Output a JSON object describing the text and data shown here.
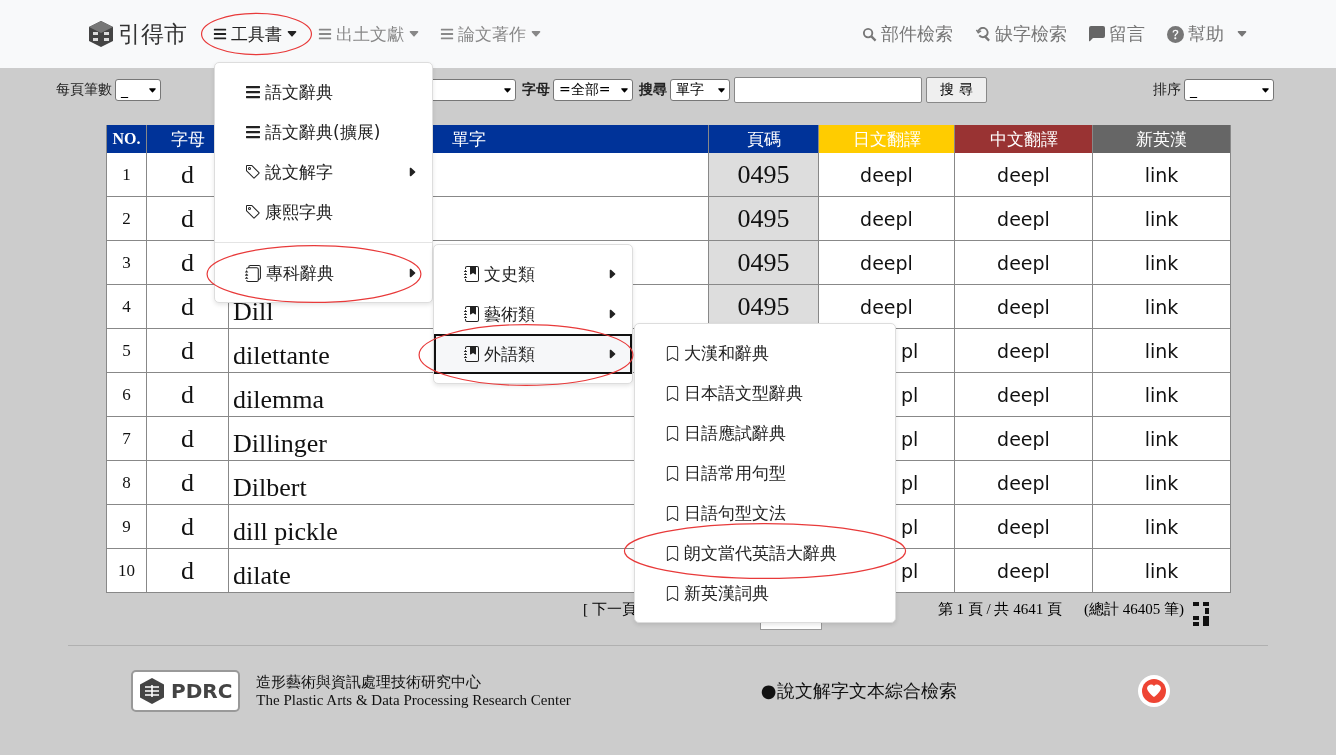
{
  "nav": {
    "brand": "引得市",
    "items": [
      {
        "label": "工具書",
        "selected": true,
        "circled": true
      },
      {
        "label": "出土文獻",
        "selected": false,
        "circled": false
      },
      {
        "label": "論文著作",
        "selected": false,
        "circled": false
      }
    ],
    "right": [
      {
        "label": "部件檢索",
        "kind": "search"
      },
      {
        "label": "缺字檢索",
        "kind": "lookup"
      },
      {
        "label": "留言",
        "kind": "messages"
      },
      {
        "label": "幫助",
        "kind": "help"
      }
    ]
  },
  "filters": {
    "per_page_label": "每頁筆數",
    "per_page": "_",
    "letter_label": "字母",
    "letter": "=全部=",
    "search_label": "搜尋",
    "search_mode": "單字",
    "button": "搜 尋",
    "sort_label": "排序",
    "sort": "_"
  },
  "table": {
    "columns": [
      {
        "label": "NO.",
        "color": "#003399"
      },
      {
        "label": "字母",
        "color": "#003399"
      },
      {
        "label": "單字",
        "color": "#003399"
      },
      {
        "label": "頁碼",
        "color": "#003399"
      },
      {
        "label": "日文翻譯",
        "color": "#ffcc00"
      },
      {
        "label": "中文翻譯",
        "color": "#993333"
      },
      {
        "label": "新英漢",
        "color": "#666666"
      }
    ],
    "rows": [
      {
        "no": "1",
        "letter": "d",
        "page": "0495",
        "ja": "deepl",
        "zh": "deepl",
        "en": "link"
      },
      {
        "no": "2",
        "letter": "d",
        "page": "0495",
        "ja": "deepl",
        "zh": "deepl",
        "en": "link"
      },
      {
        "no": "3",
        "letter": "d",
        "page": "0495",
        "ja": "deepl",
        "zh": "deepl",
        "en": "link"
      },
      {
        "no": "4",
        "letter": "d",
        "word": "Dill",
        "page": "0495",
        "ja": "deepl",
        "zh": "deepl",
        "en": "link"
      },
      {
        "no": "5",
        "letter": "d",
        "word": "dilettante",
        "ja": "pl",
        "ja_clipped": true,
        "zh": "deepl",
        "en": "link"
      },
      {
        "no": "6",
        "letter": "d",
        "word": "dilemma",
        "ja": "pl",
        "ja_clipped": true,
        "zh": "deepl",
        "en": "link"
      },
      {
        "no": "7",
        "letter": "d",
        "word": "Dillinger",
        "ja": "pl",
        "ja_clipped": true,
        "zh": "deepl",
        "en": "link"
      },
      {
        "no": "8",
        "letter": "d",
        "word": "Dilbert",
        "ja": "pl",
        "ja_clipped": true,
        "zh": "deepl",
        "en": "link"
      },
      {
        "no": "9",
        "letter": "d",
        "word": "dill pickle",
        "ja": "pl",
        "ja_clipped": true,
        "zh": "deepl",
        "en": "link"
      },
      {
        "no": "10",
        "letter": "d",
        "word": "dilate",
        "ja": "pl",
        "ja_clipped": true,
        "zh": "deepl",
        "en": "link"
      }
    ]
  },
  "pagination": {
    "next": "[ 下一頁",
    "pages": "第 1 頁 / 共 4641 頁",
    "total": "(總計 46405 筆)"
  },
  "footer": {
    "logo": "PDRC",
    "org_zh": "造形藝術與資訊處理技術研究中心",
    "org_en": "The Plastic Arts & Data Processing Research Center",
    "link": "●說文解字文本綜合檢索"
  },
  "menus": [
    {
      "items": [
        {
          "label": "語文辭典",
          "kind": "list",
          "submenu": false,
          "selected": false,
          "circled": false
        },
        {
          "label": "語文辭典(擴展)",
          "kind": "list",
          "submenu": false,
          "selected": false,
          "circled": false
        },
        {
          "label": "說文解字",
          "kind": "tag",
          "submenu": true,
          "selected": false,
          "circled": false
        },
        {
          "label": "康熙字典",
          "kind": "tag",
          "submenu": false,
          "selected": false,
          "circled": false
        },
        {
          "kind": "divider"
        },
        {
          "label": "專科辭典",
          "kind": "books",
          "submenu": true,
          "selected": false,
          "circled": true
        }
      ]
    },
    {
      "items": [
        {
          "label": "文史類",
          "kind": "book",
          "submenu": true,
          "selected": false,
          "circled": false
        },
        {
          "label": "藝術類",
          "kind": "book",
          "submenu": true,
          "selected": false,
          "circled": false
        },
        {
          "label": "外語類",
          "kind": "book",
          "submenu": true,
          "selected": true,
          "circled": true
        }
      ]
    },
    {
      "items": [
        {
          "label": "大漢和辭典",
          "kind": "bookmark",
          "submenu": false,
          "selected": false,
          "circled": false
        },
        {
          "label": "日本語文型辭典",
          "kind": "bookmark",
          "submenu": false,
          "selected": false,
          "circled": false
        },
        {
          "label": "日語應試辭典",
          "kind": "bookmark",
          "submenu": false,
          "selected": false,
          "circled": false
        },
        {
          "label": "日語常用句型",
          "kind": "bookmark",
          "submenu": false,
          "selected": false,
          "circled": false
        },
        {
          "label": "日語句型文法",
          "kind": "bookmark",
          "submenu": false,
          "selected": false,
          "circled": false
        },
        {
          "label": "朗文當代英語大辭典",
          "kind": "bookmark",
          "submenu": false,
          "selected": false,
          "circled": true
        },
        {
          "label": "新英漢詞典",
          "kind": "bookmark",
          "submenu": false,
          "selected": false,
          "circled": false
        }
      ]
    }
  ]
}
